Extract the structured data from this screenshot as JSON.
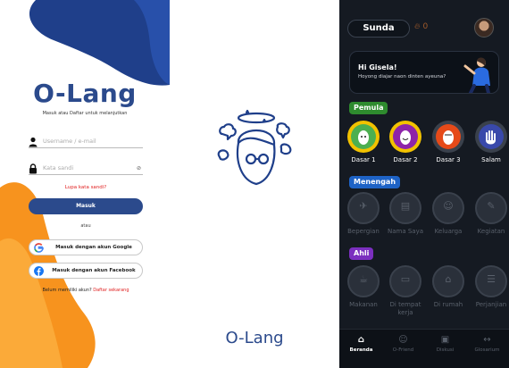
{
  "login": {
    "brand": "O-Lang",
    "tagline": "Masuk atau Daftar untuk melanjutkan",
    "username_placeholder": "Username / e-mail",
    "password_placeholder": "Kata sandi",
    "forgot": "Lupa kata sandi?",
    "submit": "Masuk",
    "or": "atau",
    "google": "Masuk dengan akun Google",
    "facebook": "Masuk dengan akun Facebook",
    "no_account": "Belum memiliki akun?",
    "register": "Daftar sekarang",
    "colors": {
      "primary": "#2b4a8c",
      "link": "#e02020",
      "accent_orange": "#f7931e"
    }
  },
  "splash": {
    "name": "O-Lang"
  },
  "home": {
    "language": "Sunda",
    "streak": "0",
    "greeting": "Hi Gisela!",
    "subgreeting": "Hoyong diajar naon dinten ayeuna?",
    "levels": [
      {
        "name": "Pemula",
        "color": "#2e8b2e",
        "units": [
          {
            "label": "Dasar 1",
            "color": "#4caf50",
            "ring": "#f2c200"
          },
          {
            "label": "Dasar 2",
            "color": "#8e24aa",
            "ring": "#f2c200"
          },
          {
            "label": "Dasar 3",
            "color": "#e64a19",
            "ring": "#3a414c"
          },
          {
            "label": "Salam",
            "color": "#3949ab",
            "ring": "#3a414c"
          }
        ]
      },
      {
        "name": "Menengah",
        "color": "#1e63c6",
        "units": [
          {
            "label": "Bepergian",
            "icon": "plane-icon"
          },
          {
            "label": "Nama Saya",
            "icon": "id-card-icon"
          },
          {
            "label": "Keluarga",
            "icon": "family-icon"
          },
          {
            "label": "Kegiatan",
            "icon": "pencil-icon"
          }
        ]
      },
      {
        "name": "Ahli",
        "color": "#7b2fbf",
        "units": [
          {
            "label": "Makanan",
            "icon": "food-icon"
          },
          {
            "label": "Di tempat kerja",
            "icon": "laptop-icon"
          },
          {
            "label": "Di rumah",
            "icon": "house-icon"
          },
          {
            "label": "Perjanjian",
            "icon": "document-icon"
          }
        ]
      }
    ],
    "tabs": [
      {
        "label": "Beranda",
        "icon": "home-icon"
      },
      {
        "label": "O-Friend",
        "icon": "person-icon"
      },
      {
        "label": "Diskusi",
        "icon": "chat-icon"
      },
      {
        "label": "Glosarium",
        "icon": "translate-icon"
      }
    ]
  }
}
